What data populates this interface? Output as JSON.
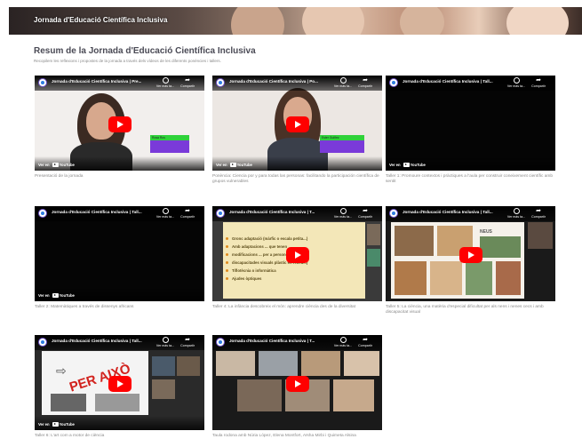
{
  "banner": {
    "title": "Jornada d'Educació Científica Inclusiva"
  },
  "page": {
    "heading": "Resum de la Jornada d'Educació Científica Inclusiva",
    "subheading": "Recopilem les reflexions i propostes de la jornada a través dels vídeos de les diferents ponències i tallers."
  },
  "player": {
    "watch_later": "Ver más ta...",
    "share": "Compartir",
    "watch_on": "Ver en",
    "youtube": "YouTube"
  },
  "videos": [
    {
      "title": "Jornada d'Educació Científica Inclusiva | Pre...",
      "caption": "Presentació de la jornada"
    },
    {
      "title": "Jornada d'Educació Científica Inclusiva | Po...",
      "caption": "Ponència: Ciencia por y para todas las personas: facilitando la participación científica de grupos vulnerables"
    },
    {
      "title": "Jornada d'Educació Científica Inclusiva | Tall...",
      "caption": "Taller 1: Promoure contextos i pràctiques a l'aula per construir coneixement científic amb sentit"
    },
    {
      "title": "Jornada d'Educació Científica Inclusiva | Tall...",
      "caption": "Taller 2: Matemàtiques a través de dissenys africans"
    },
    {
      "title": "Jornada d'Educació Científica Inclusiva | T...",
      "caption": "Taller 4: La infància descobreix el món: aprendre ciència des de la diversitat"
    },
    {
      "title": "Jornada d'Educació Científica Inclusiva | Tall...",
      "caption": "Taller 5: La ciència, una matèria d'especial dificultat per als nens i nenes cecs i amb discapacitat visual"
    },
    {
      "title": "Jornada d'Educació Científica Inclusiva | Tall...",
      "caption": "Taller 6: L'art com a motor de ciència"
    },
    {
      "title": "Jornada d'Educació Científica Inclusiva | T...",
      "caption": "Taula rodona amb Núria López, Elena Montfort, Aïsha Mirbi i Quimeta Alsina"
    }
  ],
  "slide_bullets": [
    "Gronc adaptació (màrfic o escala petita...)",
    "Amb adaptacions ... que tenen",
    "modificacions ... per a persones",
    "discapacitades visuals plàstic en relleu...)",
    "Tiflotècnia o informàtica",
    "Ajudes òptiques"
  ],
  "name_tags": [
    "Rosa Ros",
    "Ester Guiñez"
  ],
  "slide_text": {
    "taller5_label": "NEUS",
    "taller6_stamp": "PER AIXÒ"
  },
  "colors": {
    "play_red": "#ff0000",
    "tag_green": "#2fd23a",
    "tag_purple": "#7a3ad9",
    "slide_yellow": "#f3e7b8"
  }
}
